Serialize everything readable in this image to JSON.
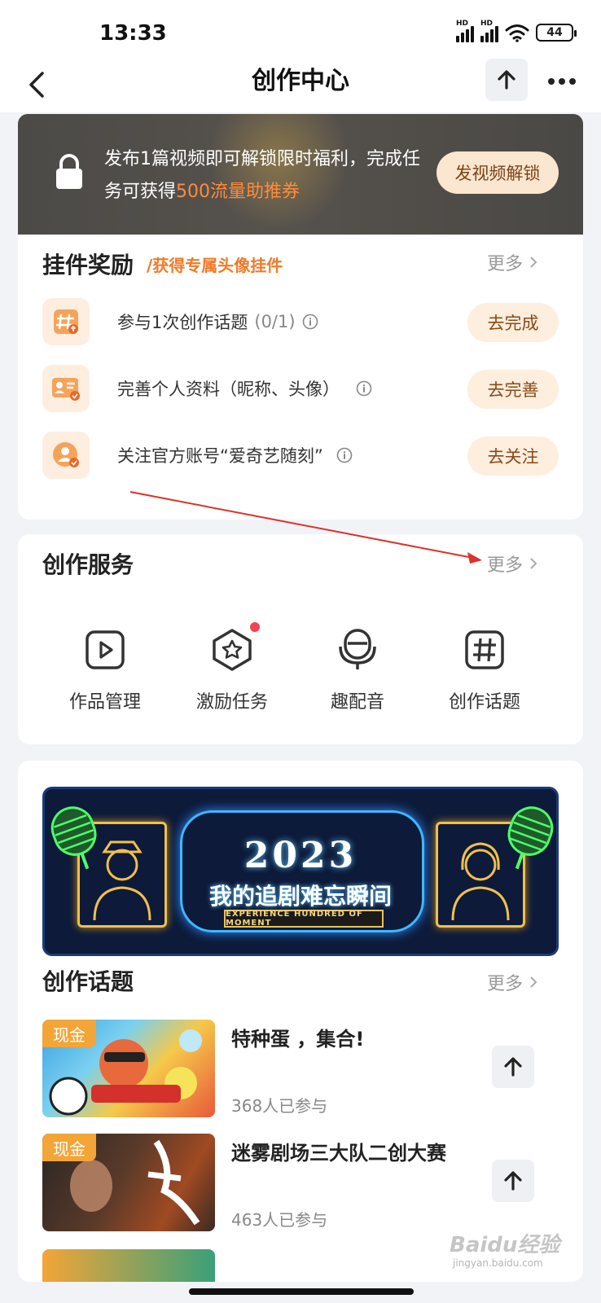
{
  "status_bar": {
    "time": "13:33",
    "battery": "44",
    "hd1": "HD",
    "hd2": "HD"
  },
  "header": {
    "title": "创作中心",
    "back_icon": "chevron-left-icon",
    "upload_icon": "arrow-up-icon",
    "more_icon": "more-dots-icon"
  },
  "promo": {
    "text_part1": "发布1篇视频即可解锁限时福利，完成任务可获得",
    "text_highlight": "500流量助推券",
    "button": "发视频解锁",
    "highlight_color": "#ff8b3d"
  },
  "pendant": {
    "title": "挂件奖励",
    "subtitle": "/获得专属头像挂件",
    "more": "更多",
    "tasks": [
      {
        "label": "参与1次创作话题",
        "progress": "(0/1)",
        "button": "去完成",
        "icon": "hashtag-upload-icon"
      },
      {
        "label": "完善个人资料（昵称、头像）",
        "progress": "",
        "button": "去完善",
        "icon": "profile-card-icon"
      },
      {
        "label": "关注官方账号“爱奇艺随刻”",
        "progress": "",
        "button": "去关注",
        "icon": "follow-user-icon"
      }
    ]
  },
  "services": {
    "title": "创作服务",
    "more": "更多",
    "items": [
      {
        "label": "作品管理",
        "icon": "play-square-icon"
      },
      {
        "label": "激励任务",
        "icon": "star-badge-icon"
      },
      {
        "label": "趣配音",
        "icon": "microphone-icon"
      },
      {
        "label": "创作话题",
        "icon": "hashtag-icon"
      }
    ]
  },
  "event_banner": {
    "year": "2023",
    "title": "我的追剧难忘瞬间",
    "ribbon": "EXPERIENCE HUNDRED OF MOMENT"
  },
  "topics": {
    "title": "创作话题",
    "more": "更多",
    "items": [
      {
        "tag": "现金",
        "name": "特种蛋 ，集合!",
        "count": "368人已参与"
      },
      {
        "tag": "现金",
        "name": "迷雾剧场三大队二创大赛",
        "count": "463人已参与"
      }
    ]
  },
  "watermark": {
    "text": "Baidu经验",
    "sub": "jingyan.baidu.com"
  }
}
